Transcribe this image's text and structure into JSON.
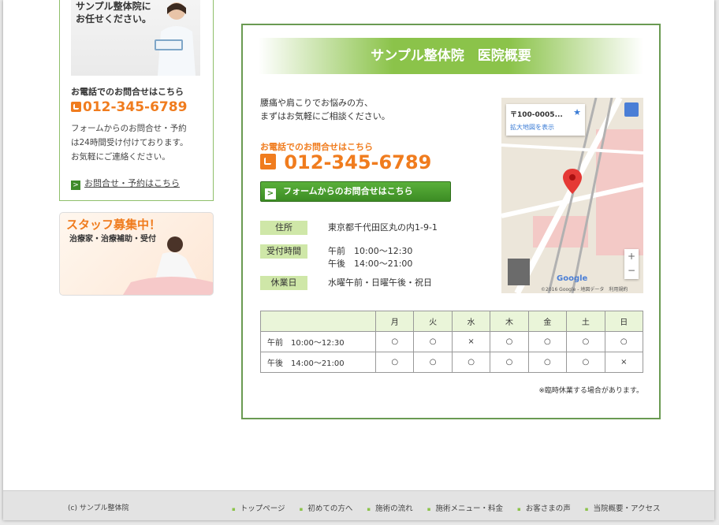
{
  "sidebar": {
    "promo_line1": "サンプル整体院に",
    "promo_line2": "お任せください。",
    "tel_label": "お電話でのお問合せはこちら",
    "tel": "012-345-6789",
    "text_line1": "フォームからのお問合せ・予約",
    "text_line2": "は24時間受け付けております。",
    "text_line3": "お気軽にご連絡ください。",
    "contact_link": "お問合せ・予約はこちら",
    "staff_title": "スタッフ募集中！",
    "staff_subtitle": "治療家・治療補助・受付"
  },
  "main": {
    "heading": "サンプル整体院　医院概要",
    "intro_line1": "腰痛や肩こりでお悩みの方、",
    "intro_line2": "まずはお気軽にご相談ください。",
    "tel_label": "お電話でのお問合せはこちら",
    "tel": "012-345-6789",
    "form_button": "フォームからのお問合せはこちら",
    "address_label": "住所",
    "address": "東京都千代田区丸の内1-9-1",
    "hours_label": "受付時間",
    "hours_am": "午前　10:00～12:30",
    "hours_pm": "午後　14:00～21:00",
    "closed_label": "休業日",
    "closed": "水曜午前・日曜午後・祝日",
    "note": "※臨時休業する場合があります。"
  },
  "map": {
    "zip": "〒100-0005...",
    "link": "拡大地図を表示",
    "brand": "Google",
    "copyright": "©2016 Google - 地図データ　利用規約"
  },
  "schedule": {
    "days": [
      "月",
      "火",
      "水",
      "木",
      "金",
      "土",
      "日"
    ],
    "rows": [
      {
        "label": "午前　10:00～12:30",
        "cells": [
          "○",
          "○",
          "×",
          "○",
          "○",
          "○",
          "○"
        ]
      },
      {
        "label": "午後　14:00～21:00",
        "cells": [
          "○",
          "○",
          "○",
          "○",
          "○",
          "○",
          "×"
        ]
      }
    ]
  },
  "footer": {
    "copyright": "(c) サンプル整体院",
    "nav": [
      "トップページ",
      "初めての方へ",
      "施術の流れ",
      "施術メニュー・料金",
      "お客さまの声",
      "当院概要・アクセス"
    ]
  },
  "colors": {
    "accent_orange": "#f07c1e",
    "accent_green": "#8bc34a",
    "border_green": "#6a9a52"
  }
}
